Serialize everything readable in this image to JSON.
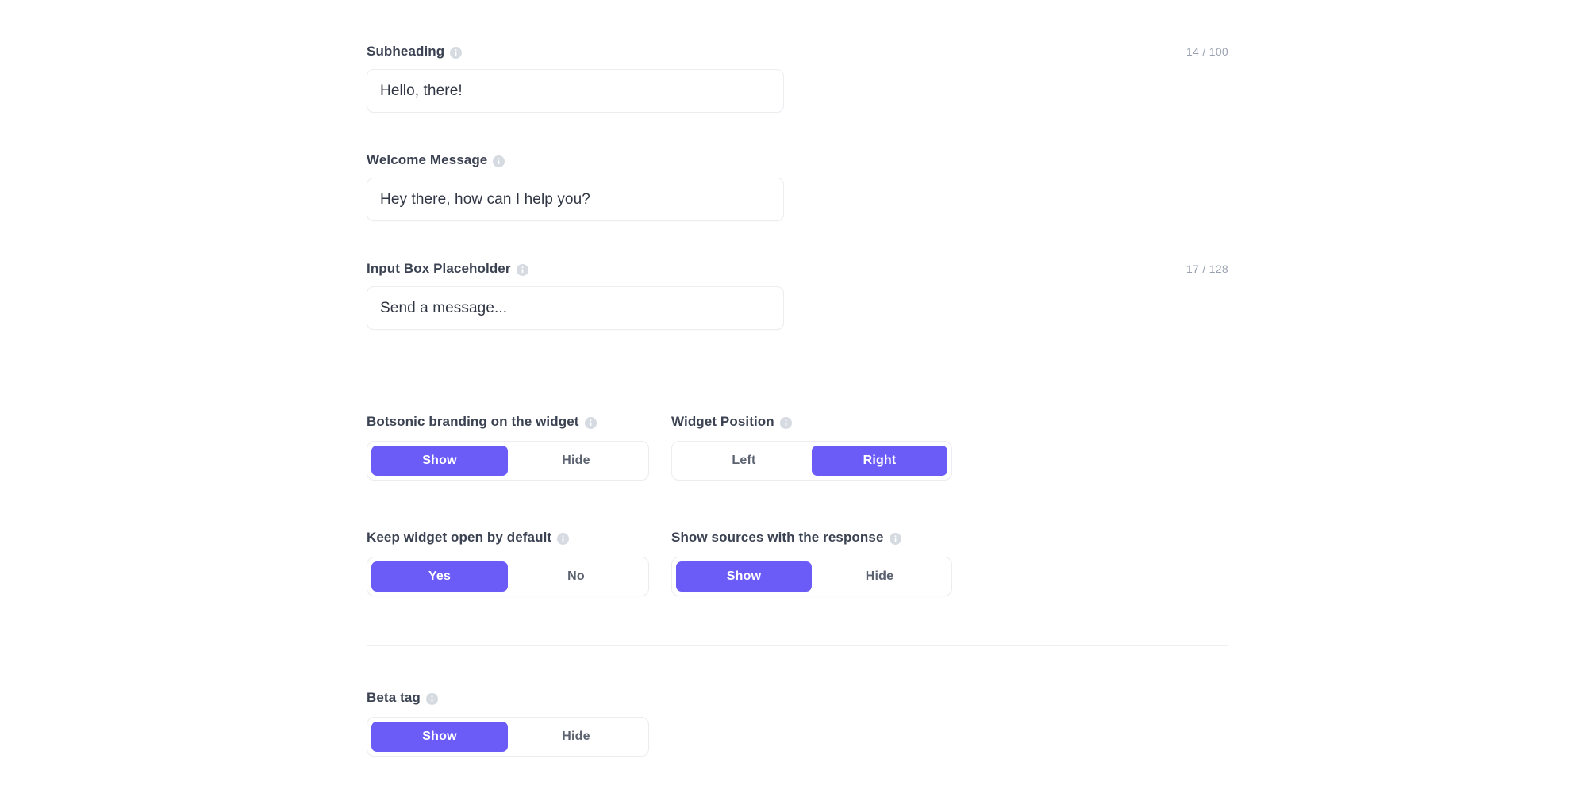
{
  "colors": {
    "accent": "#6C5CF7",
    "label": "#3B4252",
    "value_text": "#2F3542",
    "muted": "#9AA1B0",
    "border": "#ECECF1",
    "divider": "#EEEFF3",
    "info_icon_bg": "#D6DAE1"
  },
  "fields": [
    {
      "label": "Subheading",
      "info_icon": "info-icon",
      "value": "Hello, there!",
      "placeholder": "Hello, there!",
      "counter": "14 / 100"
    },
    {
      "label": "Welcome Message",
      "info_icon": "info-icon",
      "value": "Hey there, how can I help you?",
      "placeholder": "Hey there, how can I help you?",
      "counter": ""
    },
    {
      "label": "Input Box Placeholder",
      "info_icon": "info-icon",
      "value": "Send a message...",
      "placeholder": "Send a message...",
      "counter": "17 / 128"
    }
  ],
  "toggles": [
    {
      "label": "Botsonic branding on the widget",
      "info_icon": "info-icon",
      "options": [
        "Show",
        "Hide"
      ],
      "selected": "Show"
    },
    {
      "label": "Widget Position",
      "info_icon": "info-icon",
      "options": [
        "Left",
        "Right"
      ],
      "selected": "Right"
    },
    {
      "label": "Keep widget open by default",
      "info_icon": "info-icon",
      "options": [
        "Yes",
        "No"
      ],
      "selected": "Yes"
    },
    {
      "label": "Show sources with the response",
      "info_icon": "info-icon",
      "options": [
        "Show",
        "Hide"
      ],
      "selected": "Show"
    },
    {
      "label": "Beta tag",
      "info_icon": "info-icon",
      "options": [
        "Show",
        "Hide"
      ],
      "selected": "Show"
    }
  ]
}
